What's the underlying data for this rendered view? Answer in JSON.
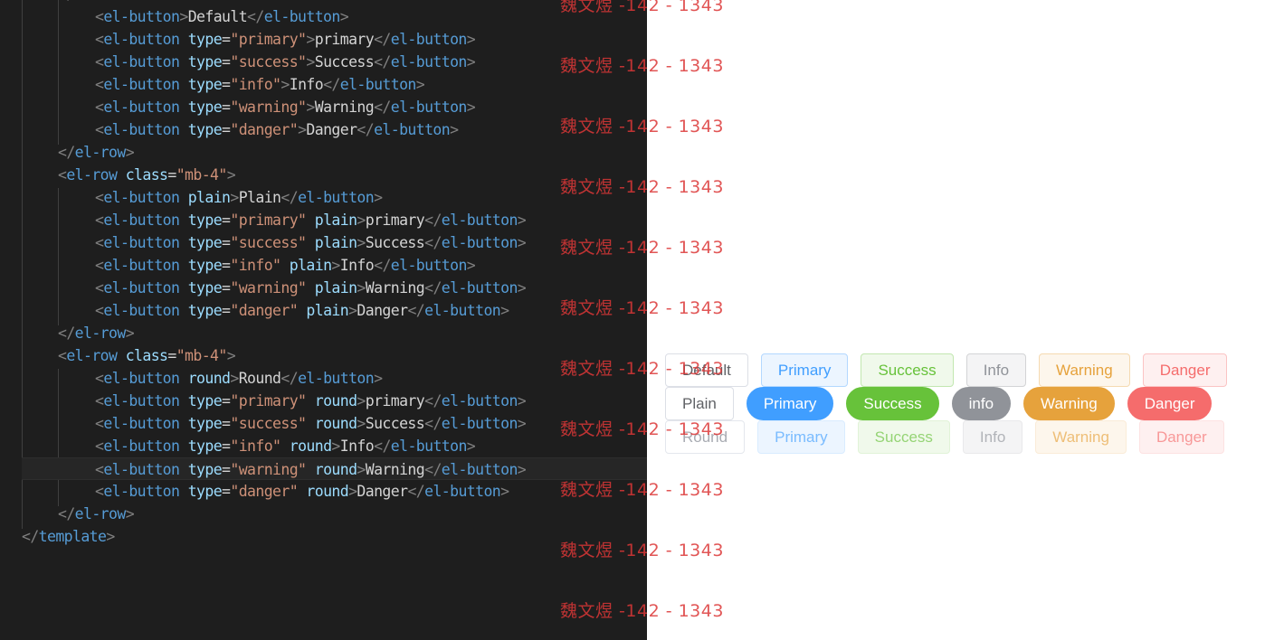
{
  "editor": {
    "lines": [
      {
        "indent": 2,
        "kind": "button",
        "type": "",
        "modifier": "",
        "text": "Default"
      },
      {
        "indent": 2,
        "kind": "button",
        "type": "primary",
        "modifier": "",
        "text": "primary"
      },
      {
        "indent": 2,
        "kind": "button",
        "type": "success",
        "modifier": "",
        "text": "Success"
      },
      {
        "indent": 2,
        "kind": "button",
        "type": "info",
        "modifier": "",
        "text": "Info"
      },
      {
        "indent": 2,
        "kind": "button",
        "type": "warning",
        "modifier": "",
        "text": "Warning"
      },
      {
        "indent": 2,
        "kind": "button",
        "type": "danger",
        "modifier": "",
        "text": "Danger"
      },
      {
        "indent": 1,
        "kind": "close",
        "tag": "el-row"
      },
      {
        "indent": 1,
        "kind": "open",
        "tag": "el-row",
        "attr": "class",
        "value": "mb-4"
      },
      {
        "indent": 2,
        "kind": "button",
        "type": "",
        "modifier": "plain",
        "text": "Plain"
      },
      {
        "indent": 2,
        "kind": "button",
        "type": "primary",
        "modifier": "plain",
        "text": "primary"
      },
      {
        "indent": 2,
        "kind": "button",
        "type": "success",
        "modifier": "plain",
        "text": "Success"
      },
      {
        "indent": 2,
        "kind": "button",
        "type": "info",
        "modifier": "plain",
        "text": "Info"
      },
      {
        "indent": 2,
        "kind": "button",
        "type": "warning",
        "modifier": "plain",
        "text": "Warning"
      },
      {
        "indent": 2,
        "kind": "button",
        "type": "danger",
        "modifier": "plain",
        "text": "Danger"
      },
      {
        "indent": 1,
        "kind": "close",
        "tag": "el-row"
      },
      {
        "indent": 1,
        "kind": "open",
        "tag": "el-row",
        "attr": "class",
        "value": "mb-4"
      },
      {
        "indent": 2,
        "kind": "button",
        "type": "",
        "modifier": "round",
        "text": "Round"
      },
      {
        "indent": 2,
        "kind": "button",
        "type": "primary",
        "modifier": "round",
        "text": "primary"
      },
      {
        "indent": 2,
        "kind": "button",
        "type": "success",
        "modifier": "round",
        "text": "Success"
      },
      {
        "indent": 2,
        "kind": "button",
        "type": "info",
        "modifier": "round",
        "text": "Info"
      },
      {
        "indent": 2,
        "kind": "button",
        "type": "warning",
        "modifier": "round",
        "text": "Warning",
        "cursor": true
      },
      {
        "indent": 2,
        "kind": "button",
        "type": "danger",
        "modifier": "round",
        "text": "Danger"
      },
      {
        "indent": 1,
        "kind": "close",
        "tag": "el-row"
      },
      {
        "indent": 0,
        "kind": "close",
        "tag": "template"
      }
    ],
    "partial_first_line": "</el-row>"
  },
  "preview": {
    "rows": [
      {
        "style": "default",
        "buttons": [
          {
            "label": "Default",
            "bg": "#ffffff",
            "border": "#dcdfe6",
            "color": "#606266"
          },
          {
            "label": "Primary",
            "bg": "#ecf5ff",
            "border": "#b3d8ff",
            "color": "#409eff"
          },
          {
            "label": "Success",
            "bg": "#f0f9eb",
            "border": "#c2e7b0",
            "color": "#67c23a"
          },
          {
            "label": "Info",
            "bg": "#f4f4f5",
            "border": "#d3d4d6",
            "color": "#909399"
          },
          {
            "label": "Warning",
            "bg": "#fdf6ec",
            "border": "#f5dab1",
            "color": "#e6a23c"
          },
          {
            "label": "Danger",
            "bg": "#fef0f0",
            "border": "#fbc4c4",
            "color": "#f56c6c"
          }
        ]
      },
      {
        "style": "round",
        "buttons": [
          {
            "label": "Plain",
            "bg": "#ffffff",
            "border": "#dcdfe6",
            "color": "#606266"
          },
          {
            "label": "Primary",
            "bg": "#409eff",
            "border": "#409eff",
            "color": "#ffffff"
          },
          {
            "label": "Success",
            "bg": "#67c23a",
            "border": "#67c23a",
            "color": "#ffffff"
          },
          {
            "label": "info",
            "bg": "#909399",
            "border": "#909399",
            "color": "#ffffff"
          },
          {
            "label": "Warning",
            "bg": "#e6a23c",
            "border": "#e6a23c",
            "color": "#ffffff"
          },
          {
            "label": "Danger",
            "bg": "#f56c6c",
            "border": "#f56c6c",
            "color": "#ffffff"
          }
        ]
      },
      {
        "style": "faint",
        "buttons": [
          {
            "label": "Round",
            "bg": "#ffffff",
            "border": "#e4e7ed",
            "color": "#a8abb2"
          },
          {
            "label": "Primary",
            "bg": "#ecf5ff",
            "border": "#d9ecff",
            "color": "#79bbff"
          },
          {
            "label": "Success",
            "bg": "#f0f9eb",
            "border": "#e1f3d8",
            "color": "#95d475"
          },
          {
            "label": "Info",
            "bg": "#f4f4f5",
            "border": "#e9e9eb",
            "color": "#b1b3b8"
          },
          {
            "label": "Warning",
            "bg": "#fdf6ec",
            "border": "#faecd8",
            "color": "#eebe77"
          },
          {
            "label": "Danger",
            "bg": "#fef0f0",
            "border": "#fde2e2",
            "color": "#f89898"
          }
        ]
      }
    ]
  },
  "watermark": {
    "text": "魏文煜 -142 - 1343",
    "count": 11
  }
}
